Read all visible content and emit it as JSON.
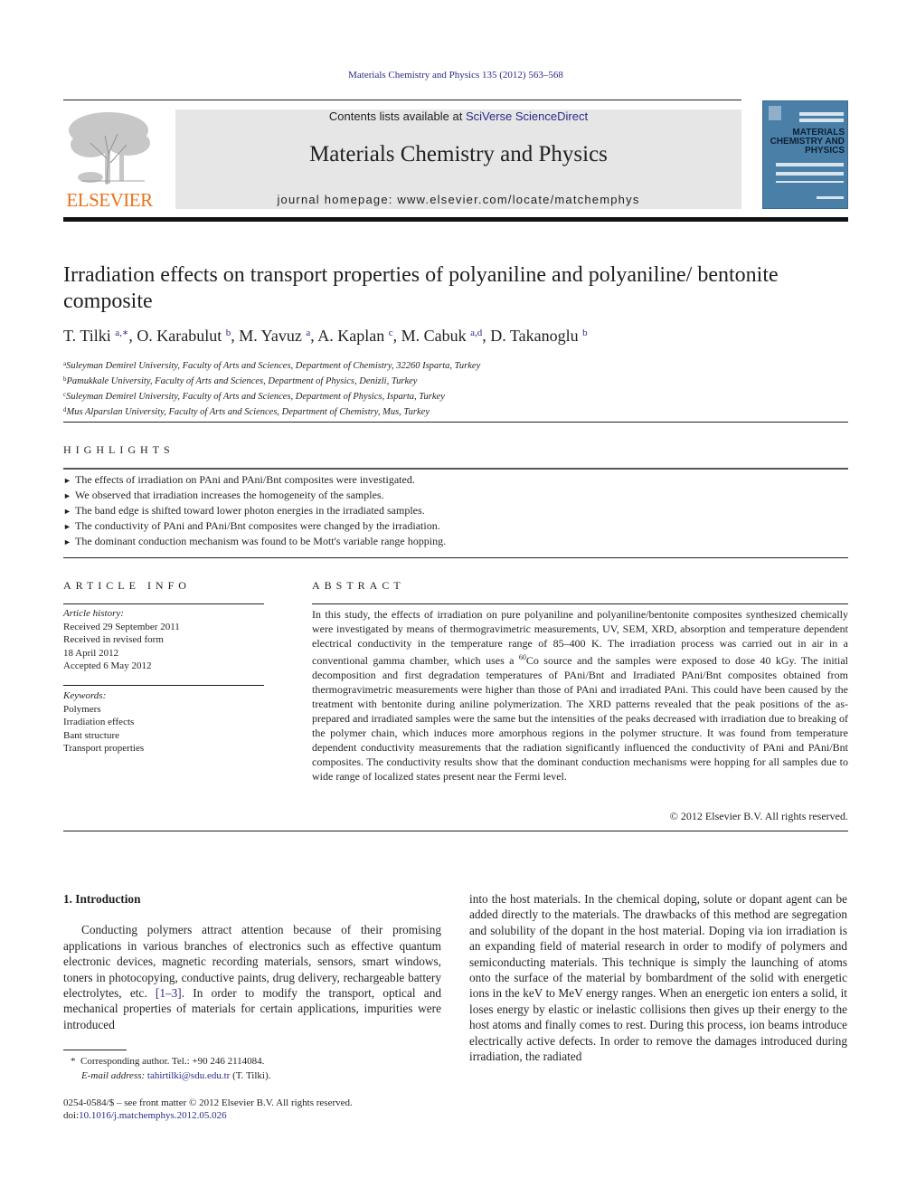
{
  "header": {
    "citation": "Materials Chemistry and Physics 135 (2012) 563–568",
    "contents_prefix": "Contents lists available at ",
    "contents_link": "SciVerse ScienceDirect",
    "journal_title": "Materials Chemistry and Physics",
    "homepage_prefix": "journal homepage: ",
    "homepage_url": "www.elsevier.com/locate/matchemphys",
    "publisher_logo": "ELSEVIER",
    "cover_title": "MATERIALS\nCHEMISTRY AND\nPHYSICS",
    "colors": {
      "publisher_orange": "#e9711c",
      "link_blue": "#2a2a8a",
      "banner_gray": "#e6e6e6",
      "cover_blue": "#4a7fa8"
    }
  },
  "article": {
    "title": "Irradiation effects on transport properties of polyaniline and polyaniline/ bentonite composite",
    "authors": [
      {
        "name": "T. Tilki",
        "sup": "a,∗"
      },
      {
        "name": "O. Karabulut",
        "sup": "b"
      },
      {
        "name": "M. Yavuz",
        "sup": "a"
      },
      {
        "name": "A. Kaplan",
        "sup": "c"
      },
      {
        "name": "M. Cabuk",
        "sup": "a,d"
      },
      {
        "name": "D. Takanoglu",
        "sup": "b"
      }
    ],
    "affiliations": [
      {
        "key": "a",
        "text": "Suleyman Demirel University, Faculty of Arts and Sciences, Department of Chemistry, 32260 Isparta, Turkey"
      },
      {
        "key": "b",
        "text": "Pamukkale University, Faculty of Arts and Sciences, Department of Physics, Denizli, Turkey"
      },
      {
        "key": "c",
        "text": "Suleyman Demirel University, Faculty of Arts and Sciences, Department of Physics, Isparta, Turkey"
      },
      {
        "key": "d",
        "text": "Mus Alparslan University, Faculty of Arts and Sciences, Department of Chemistry, Mus, Turkey"
      }
    ]
  },
  "highlights": {
    "heading": "HIGHLIGHTS",
    "bullet": "►",
    "items": [
      "The effects of irradiation on PAni and PAni/Bnt composites were investigated.",
      "We observed that irradiation increases the homogeneity of the samples.",
      "The band edge is shifted toward lower photon energies in the irradiated samples.",
      "The conductivity of PAni and PAni/Bnt composites were changed by the irradiation.",
      "The dominant conduction mechanism was found to be Mott's variable range hopping."
    ]
  },
  "article_info": {
    "heading": "ARTICLE INFO",
    "history_label": "Article history:",
    "history": [
      "Received 29 September 2011",
      "Received in revised form",
      "18 April 2012",
      "Accepted 6 May 2012"
    ],
    "keywords_label": "Keywords:",
    "keywords": [
      "Polymers",
      "Irradiation effects",
      "Bant structure",
      "Transport properties"
    ]
  },
  "abstract": {
    "heading": "ABSTRACT",
    "text_part1": "In this study, the effects of irradiation on pure polyaniline and polyaniline/bentonite composites synthesized chemically were investigated by means of thermogravimetric measurements, UV, SEM, XRD, absorption and temperature dependent electrical conductivity in the temperature range of 85–400 K. The irradiation process was carried out in air in a conventional gamma chamber, which uses a ",
    "isotope_mass": "60",
    "isotope": "Co",
    "text_part2": " source and the samples were exposed to dose 40 kGy. The initial decomposition and first degradation temperatures of PAni/Bnt and Irradiated PAni/Bnt composites obtained from thermogravimetric measurements were higher than those of PAni and irradiated PAni. This could have been caused by the treatment with bentonite during aniline polymerization. The XRD patterns revealed that the peak positions of the as-prepared and irradiated samples were the same but the intensities of the peaks decreased with irradiation due to breaking of the polymer chain, which induces more amorphous regions in the polymer structure. It was found from temperature dependent conductivity measurements that the radiation significantly influenced the conductivity of PAni and PAni/Bnt composites. The conductivity results show that the dominant conduction mechanisms were hopping for all samples due to wide range of localized states present near the Fermi level.",
    "copyright": "© 2012 Elsevier B.V. All rights reserved."
  },
  "body": {
    "section_heading": "1.  Introduction",
    "left_part1": "Conducting polymers attract attention because of their promising applications in various branches of electronics such as effective quantum electronic devices, magnetic recording materials, sensors, smart windows, toners in photocopying, conductive paints, drug delivery, rechargeable battery electrolytes, etc. ",
    "left_ref": "[1–3]",
    "left_part2": ". In order to modify the transport, optical and mechanical properties of materials for certain applications, impurities were introduced",
    "right_text": "into the host materials. In the chemical doping, solute or dopant agent can be added directly to the materials. The drawbacks of this method are segregation and solubility of the dopant in the host material. Doping via ion irradiation is an expanding field of material research in order to modify of polymers and semiconducting materials. This technique is simply the launching of atoms onto the surface of the material by bombardment of the solid with energetic ions in the keV to MeV energy ranges. When an energetic ion enters a solid, it loses energy by elastic or inelastic collisions then gives up their energy to the host atoms and finally comes to rest. During this process, ion beams introduce electrically active defects. In order to remove the damages introduced during irradiation, the radiated"
  },
  "footnote": {
    "star": "*",
    "corresponding": "Corresponding author. Tel.: +90 246 2114084.",
    "email_label": "E-mail address:",
    "email": "tahirtilki@sdu.edu.tr",
    "email_suffix": " (T. Tilki).",
    "issn_line": "0254-0584/$ – see front matter © 2012 Elsevier B.V. All rights reserved.",
    "doi_label": "doi:",
    "doi": "10.1016/j.matchemphys.2012.05.026"
  }
}
